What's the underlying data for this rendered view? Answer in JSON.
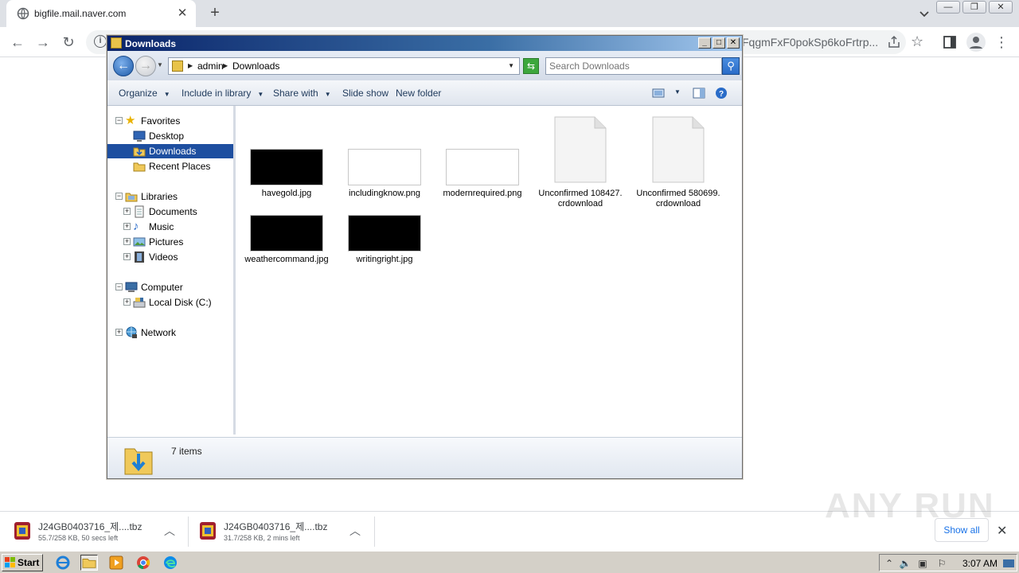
{
  "browser": {
    "tab_title": "bigfile.mail.naver.com",
    "tab_close": "✕",
    "new_tab": "+",
    "url_visible": "FqgmFxF0pokSp6koFrtrp...",
    "nav": {
      "back": "←",
      "forward": "→",
      "reload": "↻"
    }
  },
  "explorer": {
    "title": "Downloads",
    "breadcrumb": [
      "admin",
      "Downloads"
    ],
    "search_placeholder": "Search Downloads",
    "commands": {
      "organize": "Organize",
      "include_in_library": "Include in library",
      "share_with": "Share with",
      "slide_show": "Slide show",
      "new_folder": "New folder"
    },
    "nav_tree": {
      "favorites": "Favorites",
      "desktop": "Desktop",
      "downloads": "Downloads",
      "recent_places": "Recent Places",
      "libraries": "Libraries",
      "documents": "Documents",
      "music": "Music",
      "pictures": "Pictures",
      "videos": "Videos",
      "computer": "Computer",
      "local_disk": "Local Disk (C:)",
      "network": "Network"
    },
    "files": [
      {
        "name": "havegold.jpg"
      },
      {
        "name": "includingknow.png"
      },
      {
        "name": "modernrequired.png"
      },
      {
        "name": "Unconfirmed 108427.crdownload"
      },
      {
        "name": "Unconfirmed 580699.crdownload"
      },
      {
        "name": "weathercommand.jpg"
      },
      {
        "name": "writingright.jpg"
      }
    ],
    "status": "7 items"
  },
  "downloads_bar": {
    "items": [
      {
        "name": "J24GB0403716_제....tbz",
        "status": "55.7/258 KB, 50 secs left"
      },
      {
        "name": "J24GB0403716_제....tbz",
        "status": "31.7/258 KB, 2 mins left"
      }
    ],
    "show_all": "Show all",
    "close": "✕",
    "watermark": "ANY RUN"
  },
  "taskbar": {
    "start": "Start",
    "clock": "3:07 AM"
  }
}
